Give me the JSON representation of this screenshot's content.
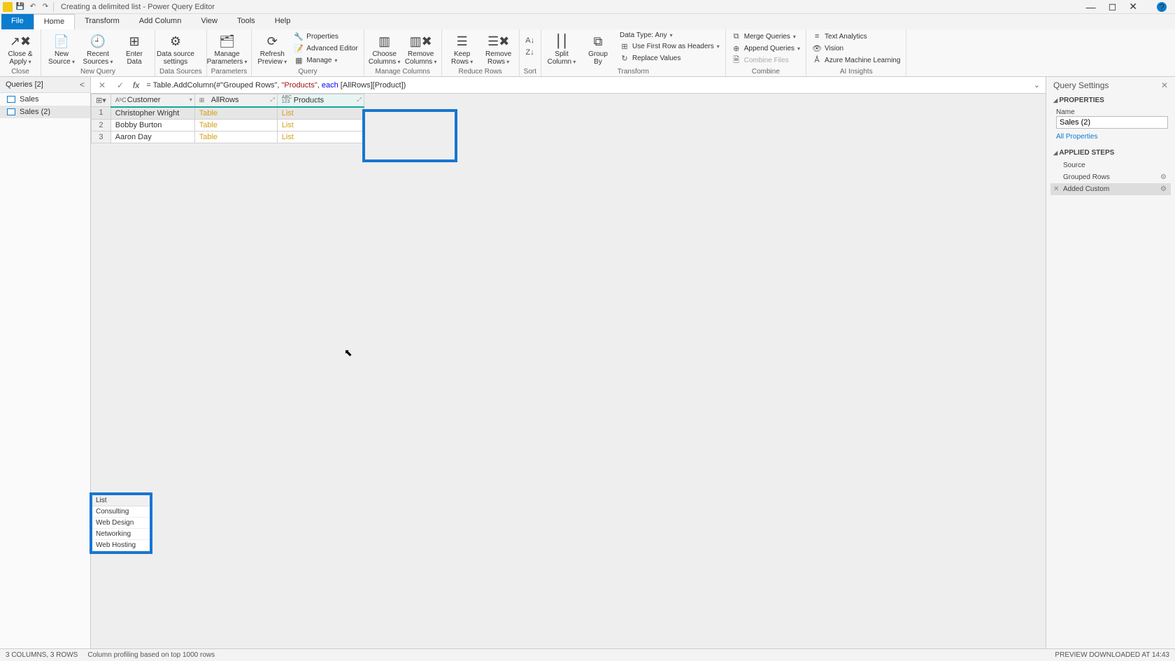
{
  "title": "Creating a delimited list - Power Query Editor",
  "menu": {
    "file": "File",
    "home": "Home",
    "transform": "Transform",
    "addcol": "Add Column",
    "view": "View",
    "tools": "Tools",
    "help": "Help"
  },
  "ribbon_groups": {
    "close": "Close",
    "newquery": "New Query",
    "datasources": "Data Sources",
    "parameters": "Parameters",
    "query": "Query",
    "managecols": "Manage Columns",
    "reducerows": "Reduce Rows",
    "sort": "Sort",
    "transform": "Transform",
    "combine": "Combine",
    "ai": "AI Insights"
  },
  "ribbon_buttons": {
    "closeapply": "Close &\nApply",
    "newsource": "New\nSource",
    "recent": "Recent\nSources",
    "enter": "Enter\nData",
    "dssettings": "Data source\nsettings",
    "mparams": "Manage\nParameters",
    "refresh": "Refresh\nPreview",
    "props": "Properties",
    "adved": "Advanced Editor",
    "manage": "Manage",
    "choose": "Choose\nColumns",
    "remove": "Remove\nColumns",
    "keep": "Keep\nRows",
    "remover": "Remove\nRows",
    "split": "Split\nColumn",
    "group": "Group\nBy",
    "datatype": "Data Type: Any",
    "firstrow": "Use First Row as Headers",
    "replace": "Replace Values",
    "merge": "Merge Queries",
    "append": "Append Queries",
    "combinef": "Combine Files",
    "textan": "Text Analytics",
    "vision": "Vision",
    "aml": "Azure Machine Learning"
  },
  "queries_pane": {
    "title": "Queries [2]",
    "items": [
      "Sales",
      "Sales (2)"
    ],
    "selected": 1
  },
  "formula": {
    "prefix": "= Table.AddColumn(#\"Grouped Rows\", ",
    "str": "\"Products\"",
    "mid": ", ",
    "kw": "each",
    "suffix": " [AllRows][Product])"
  },
  "grid": {
    "columns": [
      "Customer",
      "AllRows",
      "Products"
    ],
    "col_type_icons": [
      "AᵇC",
      "⊞",
      "ABC\n123"
    ],
    "rows": [
      {
        "n": "1",
        "customer": "Christopher Wright",
        "allrows": "Table",
        "products": "List"
      },
      {
        "n": "2",
        "customer": "Bobby Burton",
        "allrows": "Table",
        "products": "List"
      },
      {
        "n": "3",
        "customer": "Aaron Day",
        "allrows": "Table",
        "products": "List"
      }
    ]
  },
  "preview_list": {
    "header": "List",
    "items": [
      "Consulting",
      "Web Design",
      "Networking",
      "Web Hosting"
    ]
  },
  "qsettings": {
    "title": "Query Settings",
    "properties_hdr": "PROPERTIES",
    "name_lbl": "Name",
    "name_val": "Sales (2)",
    "allprops": "All Properties",
    "steps_hdr": "APPLIED STEPS",
    "steps": [
      "Source",
      "Grouped Rows",
      "Added Custom"
    ],
    "selected_step": 2
  },
  "statusbar": {
    "left": "3 COLUMNS, 3 ROWS",
    "mid": "Column profiling based on top 1000 rows",
    "right": "PREVIEW DOWNLOADED AT 14:43"
  }
}
